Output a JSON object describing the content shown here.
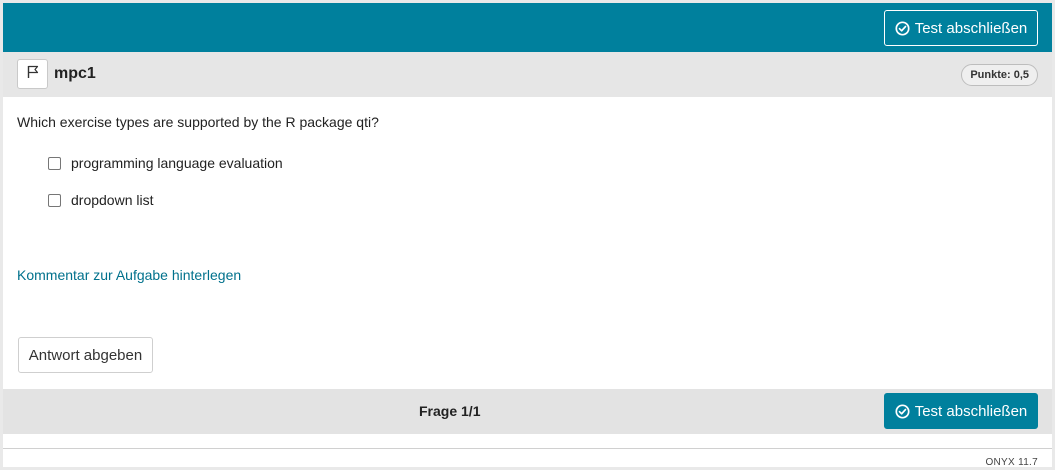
{
  "toolbar": {
    "finish_label": "Test abschließen"
  },
  "question": {
    "title": "mpc1",
    "points": "Punkte: 0,5",
    "text": "Which exercise types are supported by the R package qti?",
    "options": [
      {
        "label": "programming language evaluation",
        "checked": false
      },
      {
        "label": "dropdown list",
        "checked": false
      }
    ],
    "comment_link": "Kommentar zur Aufgabe hinterlegen",
    "submit_label": "Antwort abgeben"
  },
  "footer": {
    "progress": "Frage 1/1",
    "finish_label": "Test abschließen",
    "version": "ONYX 11.7"
  },
  "colors": {
    "accent": "#00809d",
    "link": "#00718c"
  }
}
